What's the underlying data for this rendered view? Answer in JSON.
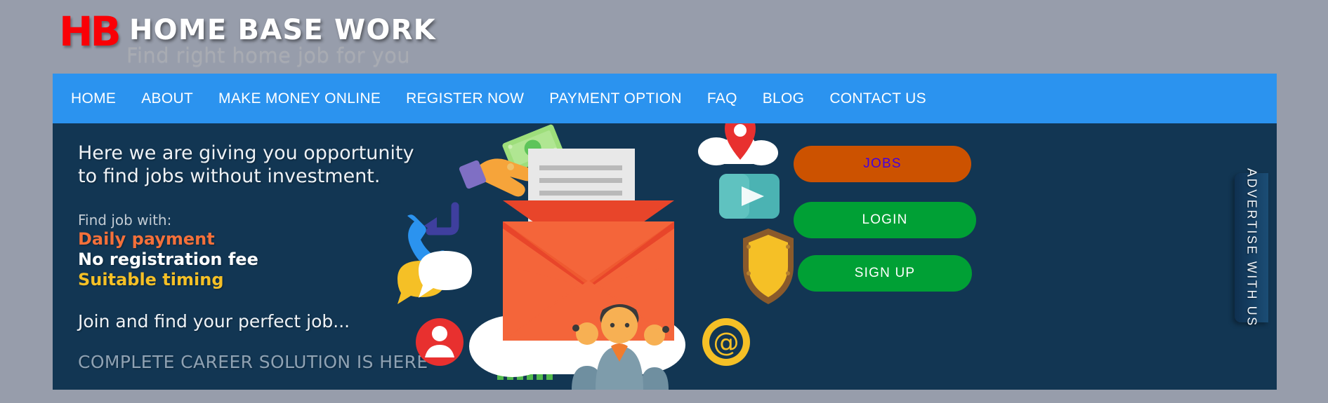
{
  "colors": {
    "page_bg": "#979dab",
    "nav_blue": "#2b93ef",
    "hero_navy": "#123653",
    "logo_red": "#fa0006",
    "jobs_orange": "#cc5200",
    "jobs_text_purple": "#4400dd",
    "green": "#00a035",
    "feature_orange": "#f4703a",
    "feature_yellow": "#f5c026"
  },
  "logo": {
    "mark": "HB",
    "title": "HOME BASE WORK",
    "tagline": "Find right home job for you"
  },
  "nav": {
    "items": [
      {
        "label": "HOME"
      },
      {
        "label": "ABOUT"
      },
      {
        "label": "MAKE MONEY ONLINE"
      },
      {
        "label": "REGISTER NOW"
      },
      {
        "label": "PAYMENT OPTION"
      },
      {
        "label": "FAQ"
      },
      {
        "label": "BLOG"
      },
      {
        "label": "CONTACT US"
      }
    ]
  },
  "hero": {
    "headline_line1": "Here we are giving you opportunity",
    "headline_line2": "to find jobs without investment.",
    "find_label": "Find job with:",
    "features": [
      {
        "label": "Daily payment",
        "color": "orange"
      },
      {
        "label": "No registration fee",
        "color": "white"
      },
      {
        "label": "Suitable timing",
        "color": "yellow"
      }
    ],
    "join_text": "Join and find your perfect job...",
    "tagline": "COMPLETE CAREER SOLUTION IS HERE"
  },
  "cta": {
    "jobs": "JOBS",
    "login": "LOGIN",
    "signup": "SIGN UP"
  },
  "advertise_tab": {
    "label": "ADVERTISE WITH US"
  },
  "illustration": {
    "description": "Open envelope with letter resting on a white cloud, surrounded by flat icons",
    "icons": [
      "hand-holding-money-icon",
      "phone-callback-icon",
      "chat-bubbles-icon",
      "user-avatar-icon",
      "growth-chart-icon",
      "people-group-icon",
      "at-symbol-icon",
      "shield-icon",
      "play-button-icon",
      "location-pin-cloud-icon"
    ]
  }
}
